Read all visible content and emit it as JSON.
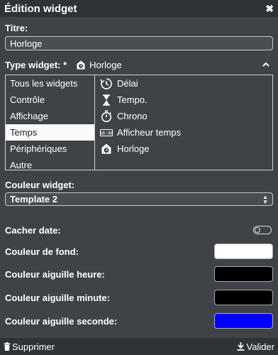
{
  "window": {
    "title": "Édition widget",
    "close_glyph": "✖"
  },
  "titre": {
    "label": "Titre:",
    "value": "Horloge"
  },
  "type_widget": {
    "label": "Type widget: *",
    "selected": "Horloge",
    "selected_icon": "house-clock-icon"
  },
  "categories": [
    {
      "label": "Tous les widgets",
      "active": false
    },
    {
      "label": "Contrôle",
      "active": false
    },
    {
      "label": "Affichage",
      "active": false
    },
    {
      "label": "Temps",
      "active": true
    },
    {
      "label": "Périphériques",
      "active": false
    },
    {
      "label": "Autre",
      "active": false
    }
  ],
  "widgets": [
    {
      "label": "Délai",
      "icon": "delay-clock-icon"
    },
    {
      "label": "Tempo.",
      "icon": "hourglass-icon"
    },
    {
      "label": "Chrono",
      "icon": "stopwatch-icon"
    },
    {
      "label": "Afficheur temps",
      "icon": "time-display-icon"
    },
    {
      "label": "Horloge",
      "icon": "house-clock-icon"
    }
  ],
  "couleur_widget": {
    "label": "Couleur widget:",
    "value": "Template 2"
  },
  "cacher_date": {
    "label": "Cacher date:",
    "on": false
  },
  "colors": [
    {
      "label": "Couleur de fond:",
      "value": "#ffffff"
    },
    {
      "label": "Couleur aiguille heure:",
      "value": "#000000"
    },
    {
      "label": "Couleur aiguille minute:",
      "value": "#000000"
    },
    {
      "label": "Couleur aiguille seconde:",
      "value": "#0000ff"
    }
  ],
  "footer": {
    "delete_label": "Supprimer",
    "validate_label": "Valider"
  }
}
